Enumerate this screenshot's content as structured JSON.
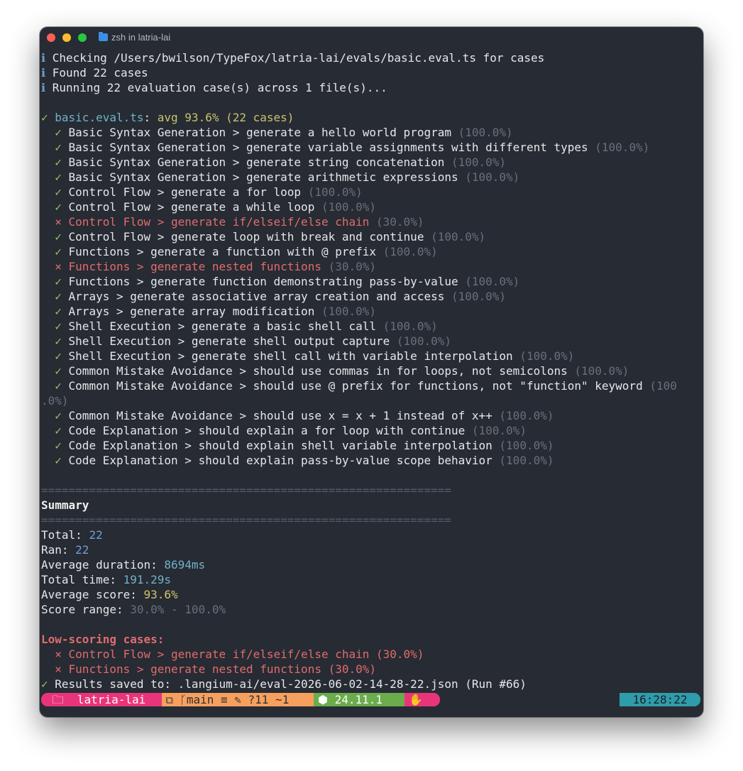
{
  "window": {
    "title": "zsh in latria-lai"
  },
  "header": [
    {
      "icon": "ℹ",
      "text": " Checking /Users/bwilson/TypeFox/latria-lai/evals/basic.eval.ts for cases"
    },
    {
      "icon": "ℹ",
      "text": " Found 22 cases"
    },
    {
      "icon": "ℹ",
      "text": " Running 22 evaluation case(s) across 1 file(s)..."
    }
  ],
  "file_line": {
    "icon": "✓",
    "file": " basic.eval.ts",
    "colon": ": ",
    "avg": "avg 93.6% (22 cases)"
  },
  "cases": [
    {
      "status": "pass",
      "text": "Basic Syntax Generation > generate a hello world program",
      "score": "(100.0%)"
    },
    {
      "status": "pass",
      "text": "Basic Syntax Generation > generate variable assignments with different types",
      "score": "(100.0%)"
    },
    {
      "status": "pass",
      "text": "Basic Syntax Generation > generate string concatenation",
      "score": "(100.0%)"
    },
    {
      "status": "pass",
      "text": "Basic Syntax Generation > generate arithmetic expressions",
      "score": "(100.0%)"
    },
    {
      "status": "pass",
      "text": "Control Flow > generate a for loop",
      "score": "(100.0%)"
    },
    {
      "status": "pass",
      "text": "Control Flow > generate a while loop",
      "score": "(100.0%)"
    },
    {
      "status": "fail",
      "text": "Control Flow > generate if/elseif/else chain",
      "score": "(30.0%)"
    },
    {
      "status": "pass",
      "text": "Control Flow > generate loop with break and continue",
      "score": "(100.0%)"
    },
    {
      "status": "pass",
      "text": "Functions > generate a function with @ prefix",
      "score": "(100.0%)"
    },
    {
      "status": "fail",
      "text": "Functions > generate nested functions",
      "score": "(30.0%)"
    },
    {
      "status": "pass",
      "text": "Functions > generate function demonstrating pass-by-value",
      "score": "(100.0%)"
    },
    {
      "status": "pass",
      "text": "Arrays > generate associative array creation and access",
      "score": "(100.0%)"
    },
    {
      "status": "pass",
      "text": "Arrays > generate array modification",
      "score": "(100.0%)"
    },
    {
      "status": "pass",
      "text": "Shell Execution > generate a basic shell call",
      "score": "(100.0%)"
    },
    {
      "status": "pass",
      "text": "Shell Execution > generate shell output capture",
      "score": "(100.0%)"
    },
    {
      "status": "pass",
      "text": "Shell Execution > generate shell call with variable interpolation",
      "score": "(100.0%)"
    },
    {
      "status": "pass",
      "text": "Common Mistake Avoidance > should use commas in for loops, not semicolons",
      "score": "(100.0%)"
    },
    {
      "status": "pass",
      "text": "Common Mistake Avoidance > should use @ prefix for functions, not \"function\" keyword",
      "score": "(100",
      "wrap": ".0%)"
    },
    {
      "status": "pass",
      "text": "Common Mistake Avoidance > should use x = x + 1 instead of x++",
      "score": "(100.0%)"
    },
    {
      "status": "pass",
      "text": "Code Explanation > should explain a for loop with continue",
      "score": "(100.0%)"
    },
    {
      "status": "pass",
      "text": "Code Explanation > should explain shell variable interpolation",
      "score": "(100.0%)"
    },
    {
      "status": "pass",
      "text": "Code Explanation > should explain pass-by-value scope behavior",
      "score": "(100.0%)"
    }
  ],
  "summary": {
    "separator": "============================================================",
    "title": "Summary",
    "total_label": "Total: ",
    "total": "22",
    "ran_label": "Ran: ",
    "ran": "22",
    "avg_dur_label": "Average duration: ",
    "avg_dur": "8694ms",
    "total_time_label": "Total time: ",
    "total_time": "191.29s",
    "avg_score_label": "Average score: ",
    "avg_score": "93.6%",
    "range_label": "Score range: ",
    "range": "30.0% - 100.0%"
  },
  "low": {
    "title": "Low-scoring cases:",
    "items": [
      "Control Flow > generate if/elseif/else chain (30.0%)",
      "Functions > generate nested functions (30.0%)"
    ]
  },
  "saved": {
    "icon": "✓",
    "text": " Results saved to: .langium-ai/eval-2026-06-02-14-28-22.json (Run #66)"
  },
  "prompt": {
    "dir": " 🗀  latria-lai",
    "git": "⧉ ᚴmain ≡ ✎ ?11 ~1",
    "node": "⬢ 24.11.1",
    "status": "✋",
    "time": "16:28:22"
  },
  "colors": {
    "pass": "#9bc36b",
    "fail": "#e06c6e",
    "info": "#6fa0c8",
    "background": "#272b33"
  }
}
